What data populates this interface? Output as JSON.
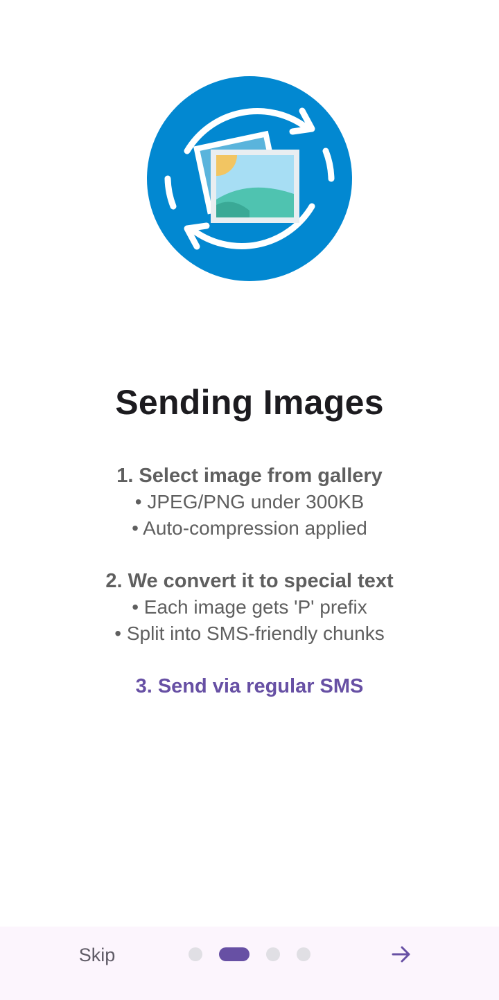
{
  "onboarding": {
    "icon": "image-sync-icon",
    "title": "Sending Images",
    "steps": [
      {
        "heading": "1. Select image from gallery",
        "bullets": [
          "• JPEG/PNG under 300KB",
          "• Auto-compression applied"
        ]
      },
      {
        "heading": "2. We convert it to special text",
        "bullets": [
          "• Each image gets 'P' prefix",
          "• Split into SMS-friendly chunks"
        ]
      },
      {
        "heading": "3. Send via regular SMS",
        "bullets": []
      }
    ]
  },
  "footer": {
    "skip_label": "Skip",
    "pager": {
      "total": 4,
      "current": 2
    },
    "next_icon": "arrow-right-icon"
  },
  "colors": {
    "accent": "#6750a4",
    "icon_blue": "#0288d1",
    "text_muted": "#5f5f5f",
    "title": "#1c1b1f",
    "bar_bg": "#fcf5fd"
  }
}
